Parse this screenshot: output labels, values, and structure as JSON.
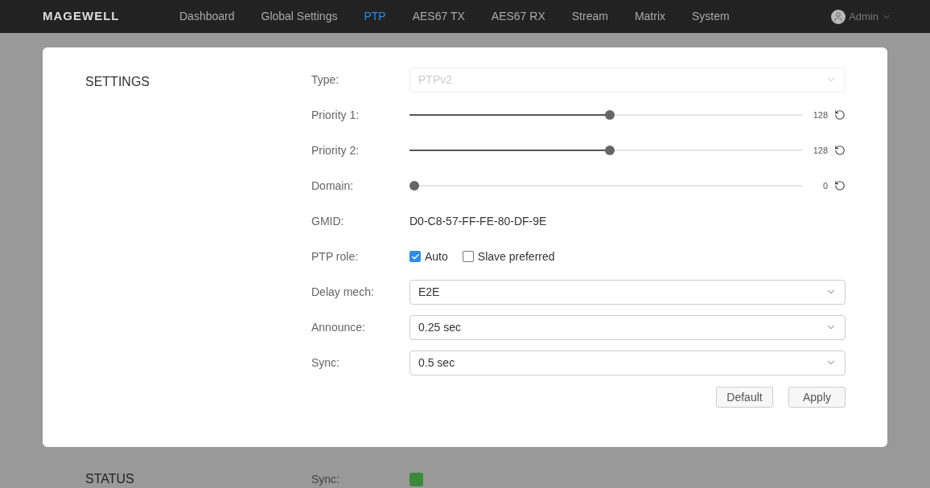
{
  "nav": {
    "logo": "MAGEWELL",
    "items": [
      {
        "label": "Dashboard",
        "selected": false
      },
      {
        "label": "Global Settings",
        "selected": false
      },
      {
        "label": "PTP",
        "selected": true
      },
      {
        "label": "AES67 TX",
        "selected": false
      },
      {
        "label": "AES67 RX",
        "selected": false
      },
      {
        "label": "Stream",
        "selected": false
      },
      {
        "label": "Matrix",
        "selected": false
      },
      {
        "label": "System",
        "selected": false
      }
    ],
    "user": "Admin"
  },
  "settings": {
    "title": "SETTINGS",
    "fields": [
      {
        "kind": "select",
        "label": "Type:",
        "value": "PTPv2",
        "disabled": true
      },
      {
        "kind": "slider",
        "label": "Priority 1:",
        "level": 0.51,
        "reading": "128"
      },
      {
        "kind": "slider",
        "label": "Priority 2:",
        "level": 0.51,
        "reading": "128"
      },
      {
        "kind": "slider",
        "label": "Domain:",
        "level": 0,
        "reading": "0"
      },
      {
        "kind": "text",
        "label": "GMID:",
        "value": "D0-C8-57-FF-FE-80-DF-9E"
      },
      {
        "kind": "checks",
        "label": "PTP role:",
        "options": [
          {
            "label": "Auto",
            "checked": true
          },
          {
            "label": "Slave preferred",
            "checked": false
          }
        ]
      },
      {
        "kind": "select",
        "label": "Delay mech:",
        "value": "E2E",
        "disabled": false
      },
      {
        "kind": "select",
        "label": "Announce:",
        "value": "0.25 sec",
        "disabled": false
      },
      {
        "kind": "select",
        "label": "Sync:",
        "value": "0.5 sec",
        "disabled": false
      }
    ],
    "buttons": [
      "Default",
      "Apply"
    ]
  },
  "status": {
    "title": "STATUS",
    "label": "Sync:",
    "color": "#3a8a3a"
  }
}
